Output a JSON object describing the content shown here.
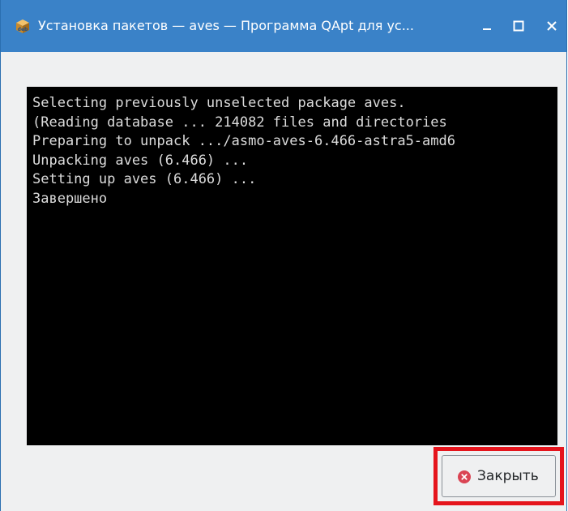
{
  "window": {
    "title": "Установка пакетов — aves — Программа QApt для ус..."
  },
  "terminal": {
    "lines": [
      "Selecting previously unselected package aves.",
      "(Reading database ... 214082 files and directories",
      "Preparing to unpack .../asmo-aves-6.466-astra5-amd6",
      "Unpacking aves (6.466) ...",
      "Setting up aves (6.466) ...",
      "Завершено"
    ]
  },
  "actions": {
    "close_label": "Закрыть"
  },
  "icons": {
    "app": "deb-package-icon",
    "minimize": "minimize-icon",
    "maximize": "maximize-icon",
    "close": "close-icon",
    "close_button": "close-circle-icon"
  },
  "colors": {
    "titlebar": "#3a82c8",
    "terminal_bg": "#000000",
    "terminal_fg": "#dcdcdc",
    "highlight": "#e5141c",
    "close_icon": "#da4453"
  }
}
